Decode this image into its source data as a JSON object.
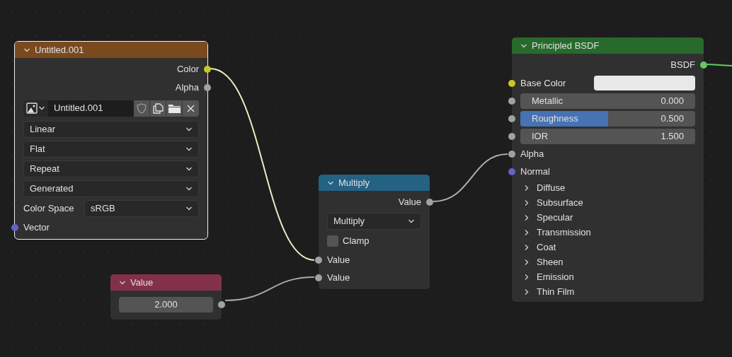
{
  "nodes": [
    {
      "title": "Untitled.001",
      "color": "#7a4a1f",
      "selected": true,
      "rows": [
        {
          "kind": "output",
          "label": "Color",
          "socket": {
            "color": "#c7c729"
          }
        },
        {
          "kind": "output",
          "label": "Alpha",
          "socket": {
            "color": "#a1a1a1"
          }
        },
        {
          "kind": "image_selector",
          "value": "Untitled.001"
        },
        {
          "kind": "dropdown",
          "value": "Linear"
        },
        {
          "kind": "dropdown",
          "value": "Flat"
        },
        {
          "kind": "dropdown",
          "value": "Repeat"
        },
        {
          "kind": "dropdown",
          "value": "Generated"
        },
        {
          "kind": "labeled_dropdown",
          "label": "Color Space",
          "value": "sRGB"
        },
        {
          "kind": "input",
          "label": "Vector",
          "socket": {
            "color": "#6363c7"
          }
        }
      ]
    },
    {
      "title": "Value",
      "color": "#83314a",
      "selected": false,
      "rows": [
        {
          "kind": "number",
          "value": "2.000",
          "socket": {
            "color": "#a1a1a1"
          }
        }
      ]
    },
    {
      "title": "Multiply",
      "color": "#246283",
      "selected": false,
      "rows": [
        {
          "kind": "output",
          "label": "Value",
          "socket": {
            "color": "#a1a1a1"
          }
        },
        {
          "kind": "dropdown",
          "value": "Multiply"
        },
        {
          "kind": "checkbox",
          "label": "Clamp",
          "checked": false
        },
        {
          "kind": "input",
          "label": "Value",
          "socket": {
            "color": "#a1a1a1"
          }
        },
        {
          "kind": "input",
          "label": "Value",
          "socket": {
            "color": "#a1a1a1"
          }
        }
      ]
    },
    {
      "title": "Principled BSDF",
      "color": "#286a2c",
      "selected": false,
      "rows": [
        {
          "kind": "output",
          "label": "BSDF",
          "socket": {
            "color": "#63c763"
          }
        },
        {
          "kind": "color_field",
          "label": "Base Color",
          "color": "#e8e8e8",
          "socket": {
            "color": "#c7c729"
          }
        },
        {
          "kind": "slider",
          "label": "Metallic",
          "value": "0.000",
          "level": 0,
          "socket": {
            "color": "#a1a1a1"
          }
        },
        {
          "kind": "slider",
          "label": "Roughness",
          "value": "0.500",
          "level": 0.5,
          "socket": {
            "color": "#a1a1a1"
          }
        },
        {
          "kind": "number_field",
          "label": "IOR",
          "value": "1.500",
          "socket": {
            "color": "#a1a1a1"
          }
        },
        {
          "kind": "input",
          "label": "Alpha",
          "socket": {
            "color": "#a1a1a1"
          }
        },
        {
          "kind": "input",
          "label": "Normal",
          "socket": {
            "color": "#6363c7"
          }
        },
        {
          "kind": "panel",
          "label": "Diffuse",
          "expanded": false
        },
        {
          "kind": "panel",
          "label": "Subsurface",
          "expanded": false
        },
        {
          "kind": "panel",
          "label": "Specular",
          "expanded": false
        },
        {
          "kind": "panel",
          "label": "Transmission",
          "expanded": false
        },
        {
          "kind": "panel",
          "label": "Coat",
          "expanded": false
        },
        {
          "kind": "panel",
          "label": "Sheen",
          "expanded": false
        },
        {
          "kind": "panel",
          "label": "Emission",
          "expanded": false
        },
        {
          "kind": "panel",
          "label": "Thin Film",
          "expanded": false
        }
      ]
    }
  ]
}
